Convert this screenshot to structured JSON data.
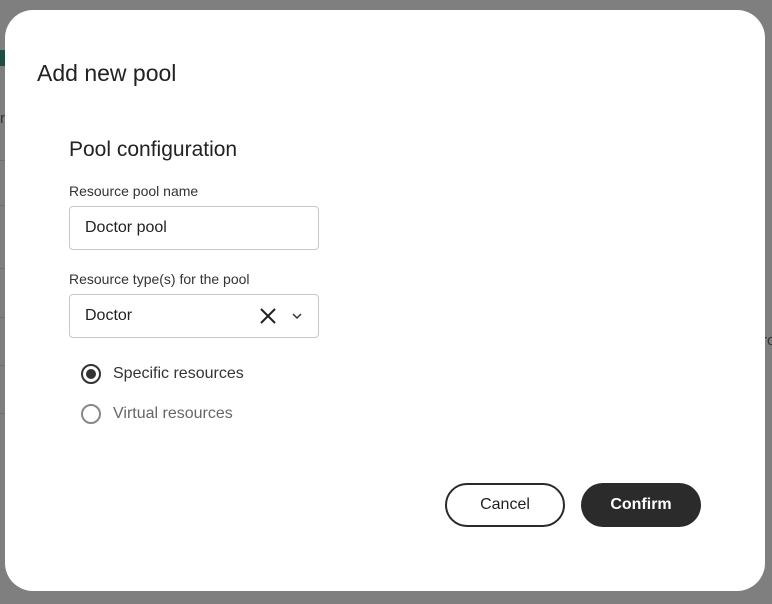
{
  "background": {
    "left_fragment": "r",
    "right_fragment": "ro"
  },
  "dialog": {
    "title": "Add new pool",
    "section_title": "Pool configuration",
    "pool_name": {
      "label": "Resource pool name",
      "value": "Doctor pool"
    },
    "resource_type": {
      "label": "Resource type(s) for the pool",
      "value": "Doctor"
    },
    "options": [
      {
        "label": "Specific resources",
        "selected": true
      },
      {
        "label": "Virtual resources",
        "selected": false
      }
    ],
    "cancel_label": "Cancel",
    "confirm_label": "Confirm"
  }
}
